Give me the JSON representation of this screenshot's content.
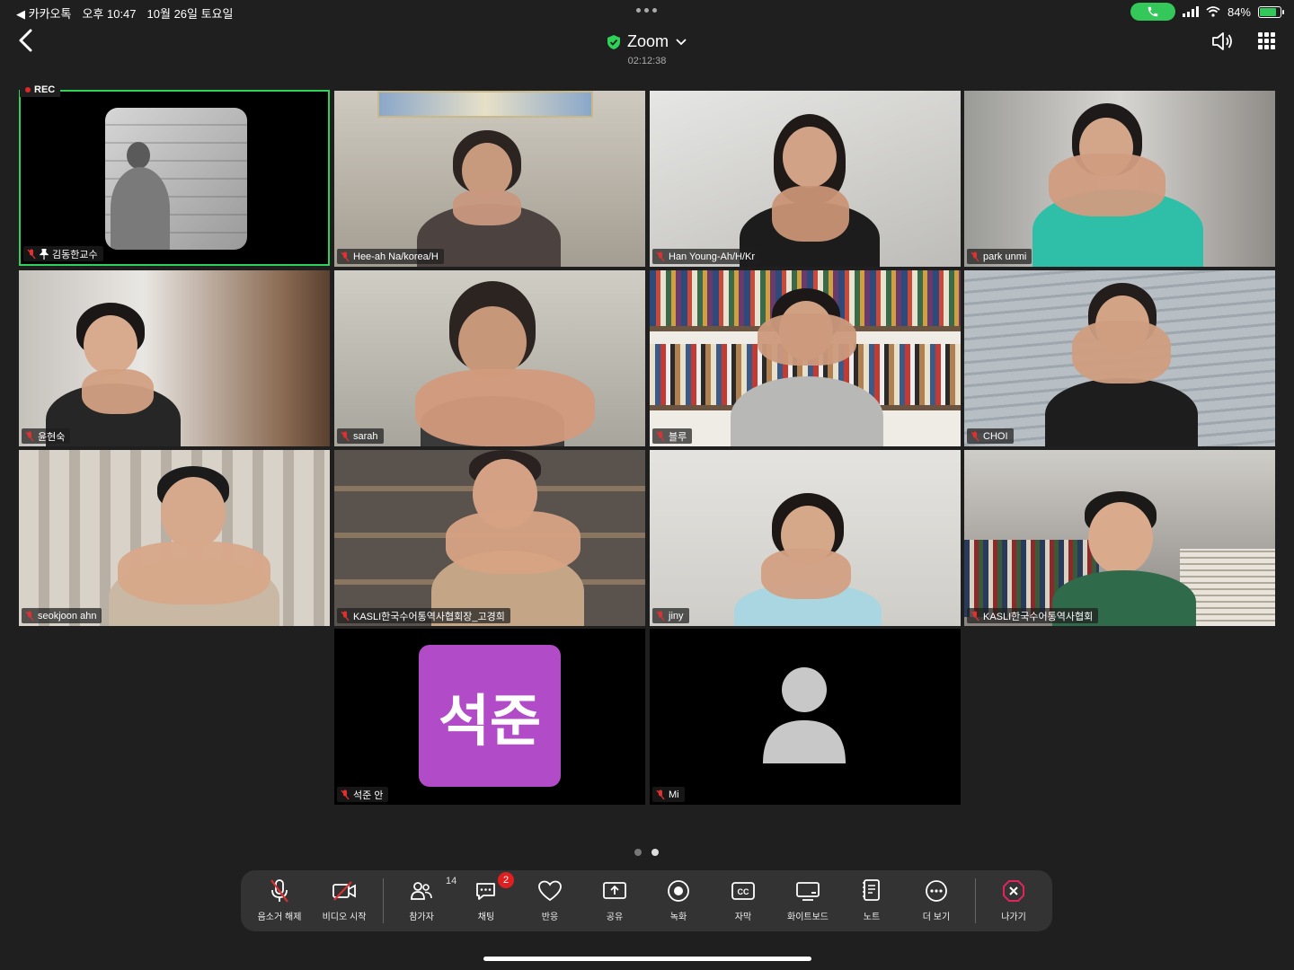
{
  "status_bar": {
    "back_app": "◀ 카카오톡",
    "time": "오후 10:47",
    "date": "10월 26일 토요일",
    "battery": "84%",
    "battery_level": 0.84
  },
  "header": {
    "title": "Zoom",
    "timer": "02:12:38"
  },
  "rec_label": "REC",
  "participants": [
    {
      "name": "김동한교수"
    },
    {
      "name": "Hee-ah Na/korea/H"
    },
    {
      "name": "Han Young-Ah/H/Kr"
    },
    {
      "name": "park unmi"
    },
    {
      "name": "윤현숙"
    },
    {
      "name": "sarah"
    },
    {
      "name": "블루"
    },
    {
      "name": "CHOI"
    },
    {
      "name": "seokjoon ahn"
    },
    {
      "name": "KASLI한국수어통역사협회장_고경희"
    },
    {
      "name": "jiny"
    },
    {
      "name": "KASLI한국수어통역사협회"
    },
    {
      "name": "석준 안",
      "avatar_text": "석준",
      "avatar_color": "#b24bc7"
    },
    {
      "name": "Mi"
    }
  ],
  "toolbar": {
    "unmute": "음소거 해제",
    "start_video": "비디오 시작",
    "participants": "참가자",
    "participants_count": "14",
    "chat": "채팅",
    "chat_badge": "2",
    "reactions": "반응",
    "share": "공유",
    "record": "녹화",
    "captions": "자막",
    "whiteboard": "화이트보드",
    "notes": "노트",
    "more": "더 보기",
    "leave": "나가기"
  },
  "colors": {
    "active_speaker_border": "#2fd158",
    "leave": "#e0245e",
    "badge": "#e02020"
  }
}
